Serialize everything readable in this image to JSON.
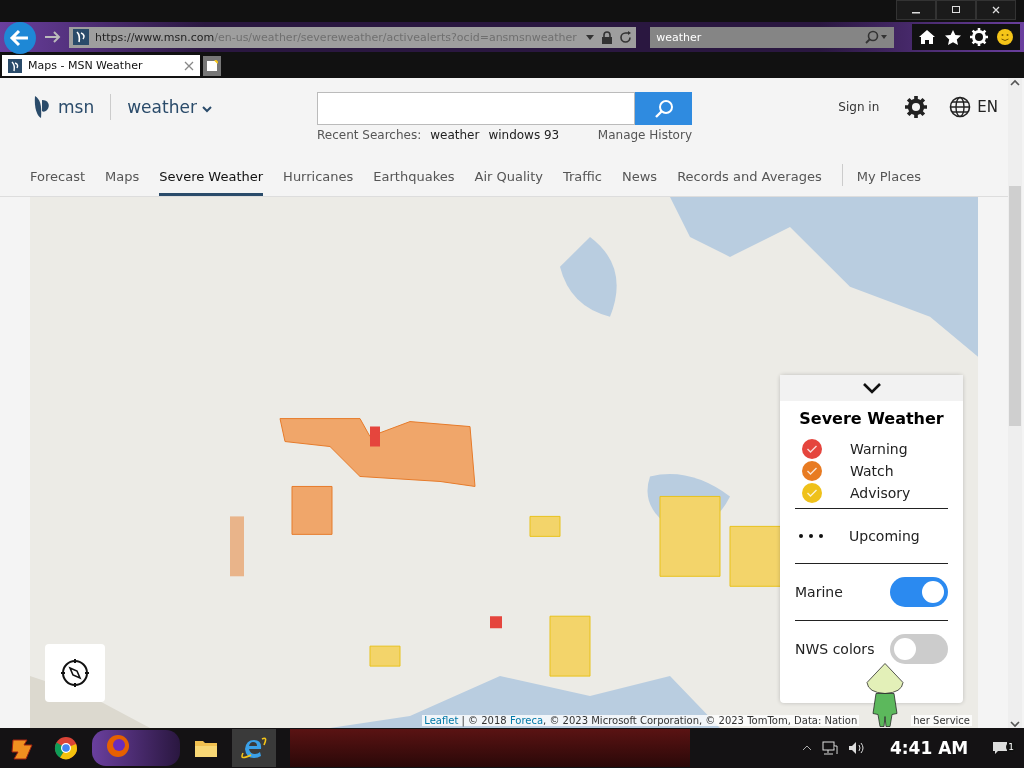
{
  "browser": {
    "address": {
      "scheme": "https://",
      "host": "www.msn.com",
      "path": "/en-us/weather/severeweather/activealerts?ocid=ansmsnweather"
    },
    "search_value": "weather",
    "tabs": [
      {
        "title": "Maps - MSN Weather",
        "selected": true
      }
    ]
  },
  "header": {
    "brand": "msn",
    "section": "weather",
    "recent_label": "Recent Searches:",
    "recent": [
      "weather",
      "windows 93"
    ],
    "manage": "Manage History",
    "sign_in": "Sign in",
    "language": "EN"
  },
  "nav": [
    {
      "label": "Forecast",
      "selected": false
    },
    {
      "label": "Maps",
      "selected": false
    },
    {
      "label": "Severe Weather",
      "selected": true
    },
    {
      "label": "Hurricanes",
      "selected": false
    },
    {
      "label": "Earthquakes",
      "selected": false
    },
    {
      "label": "Air Quality",
      "selected": false
    },
    {
      "label": "Traffic",
      "selected": false
    },
    {
      "label": "News",
      "selected": false
    },
    {
      "label": "Records and Averages",
      "selected": false
    },
    {
      "label": "My Places",
      "selected": false
    }
  ],
  "legend": {
    "title": "Severe Weather",
    "items": [
      {
        "label": "Warning",
        "color": "#e5453d",
        "checked": true
      },
      {
        "label": "Watch",
        "color": "#e87b22",
        "checked": true
      },
      {
        "label": "Advisory",
        "color": "#efc11a",
        "checked": true
      }
    ],
    "upcoming": "Upcoming",
    "toggles": [
      {
        "label": "Marine",
        "on": true
      },
      {
        "label": "NWS colors",
        "on": false
      }
    ]
  },
  "attribution": {
    "link": "Leaflet",
    "sep": "| © 2018 ",
    "source": "Foreca",
    "rest": ", © 2023 Microsoft Corporation, © 2023 TomTom, Data: Nation",
    "tail": "her Service"
  },
  "taskbar": {
    "time": "4:41 AM",
    "badge": "1"
  }
}
